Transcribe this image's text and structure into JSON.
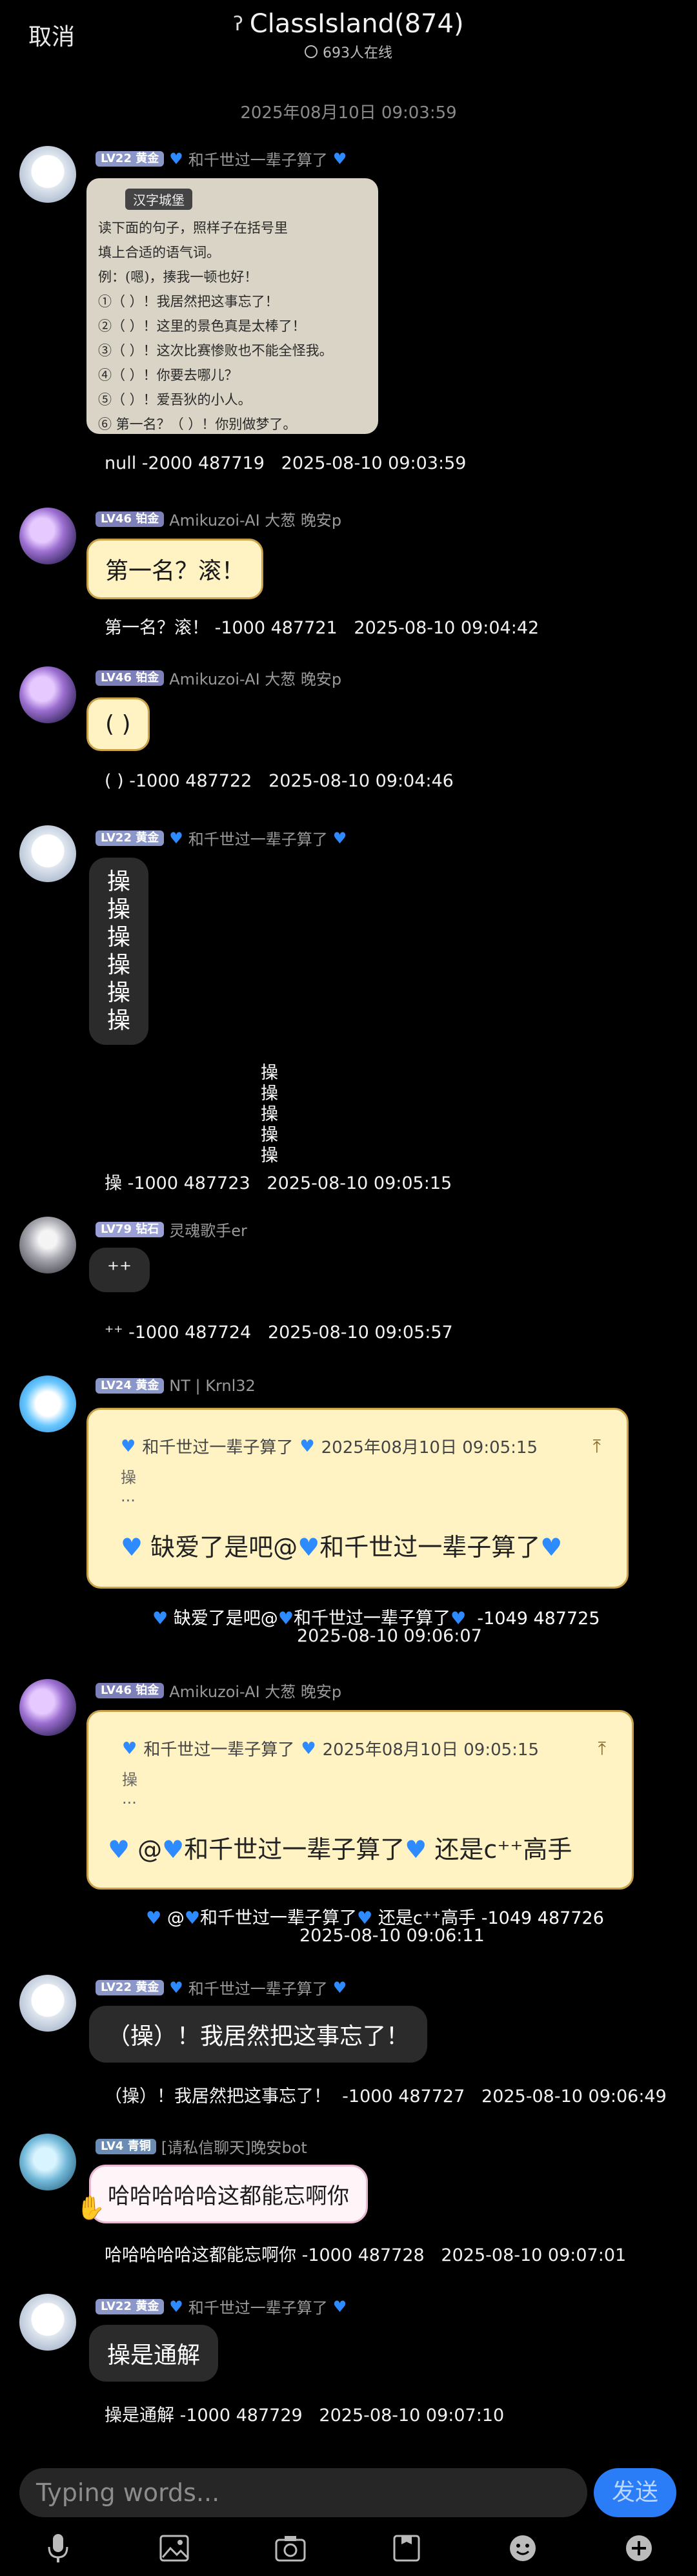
{
  "header": {
    "cancel": "取消",
    "title": "ClassIsland(874)",
    "online": "693人在线"
  },
  "time_separator": "2025年08月10日 09:03:59",
  "messages": {
    "m1": {
      "level": "LV22",
      "rank": "黄金",
      "name": "和千世过一辈子算了",
      "image_title": "汉字城堡",
      "image_lines": [
        "读下面的句子，照样子在括号里",
        "填上合适的语气词。",
        "例：(嗯)，揍我一顿也好！",
        "①（ ）！我居然把这事忘了！",
        "②（ ）！这里的景色真是太棒了！",
        "③（ ）！这次比赛惨败也不能全怪我。",
        "④（ ）！你要去哪儿？",
        "⑤（ ）！爱吾狄的小人。",
        "⑥ 第一名？（ ）！你别做梦了。"
      ],
      "caption": "null -2000 487719   2025-08-10 09:03:59"
    },
    "m2": {
      "level": "LV46",
      "rank": "铂金",
      "name": "Amikuzoi-AI 大葱 晚安p",
      "text": "第一名？滚！",
      "caption": "第一名？滚！ -1000 487721   2025-08-10 09:04:42"
    },
    "m3": {
      "level": "LV46",
      "rank": "铂金",
      "name": "Amikuzoi-AI 大葱 晚安p",
      "text": "( )",
      "caption": "( ) -1000 487722   2025-08-10 09:04:46"
    },
    "m4": {
      "level": "LV22",
      "rank": "黄金",
      "name": "和千世过一辈子算了",
      "lines": [
        "操",
        "操",
        "操",
        "操",
        "操",
        "操"
      ],
      "caption_lines": [
        "操",
        "操",
        "操",
        "操",
        "操"
      ],
      "caption": "操 -1000 487723   2025-08-10 09:05:15"
    },
    "m5": {
      "level": "LV79",
      "rank": "钻石",
      "name": "灵魂歌手er",
      "text": "⁺⁺",
      "caption": "⁺⁺ -1000 487724   2025-08-10 09:05:57"
    },
    "m6": {
      "level": "LV24",
      "rank": "黄金",
      "name": "NT | Krnl32",
      "quote_name": "和千世过一辈子算了",
      "quote_time": "2025年08月10日 09:05:15",
      "quote_text": "操",
      "quote_more": "...",
      "body": "缺爱了是吧@",
      "body_name": "和千世过一辈子算了",
      "caption1": "缺爱了是吧@",
      "caption_name": "和千世过一辈子算了",
      "caption_tail": "  -1049 487725",
      "caption2": "2025-08-10 09:06:07"
    },
    "m7": {
      "level": "LV46",
      "rank": "铂金",
      "name": "Amikuzoi-AI 大葱 晚安p",
      "quote_name": "和千世过一辈子算了",
      "quote_time": "2025年08月10日 09:05:15",
      "quote_text": "操",
      "quote_more": "...",
      "body_pre": "@",
      "body_name": "和千世过一辈子算了",
      "body_post": " 还是c⁺⁺高手",
      "caption1_pre": "@",
      "caption_name": "和千世过一辈子算了",
      "caption1_post": " 还是c⁺⁺高手 -1049 487726",
      "caption2": "2025-08-10 09:06:11"
    },
    "m8": {
      "level": "LV22",
      "rank": "黄金",
      "name": "和千世过一辈子算了",
      "text": "（操）！我居然把这事忘了！",
      "caption": "（操）！我居然把这事忘了！  -1000 487727   2025-08-10 09:06:49"
    },
    "m9": {
      "level": "LV4",
      "rank": "青铜",
      "name": "[请私信聊天]晚安bot",
      "text": "哈哈哈哈哈这都能忘啊你",
      "caption": "哈哈哈哈哈这都能忘啊你 -1000 487728   2025-08-10 09:07:01"
    },
    "m10": {
      "level": "LV22",
      "rank": "黄金",
      "name": "和千世过一辈子算了",
      "text": "操是通解",
      "caption": "操是通解 -1000 487729   2025-08-10 09:07:10"
    }
  },
  "input": {
    "placeholder": "Typing words...",
    "send": "发送"
  },
  "toolbar": [
    "microphone-icon",
    "image-icon",
    "camera-icon",
    "file-icon",
    "emoji-icon",
    "plus-icon"
  ],
  "colors": {
    "background": "#000000",
    "send": "#2b7df7",
    "heart": "#2e8bff",
    "yellow_bubble": "#fff3c4"
  }
}
